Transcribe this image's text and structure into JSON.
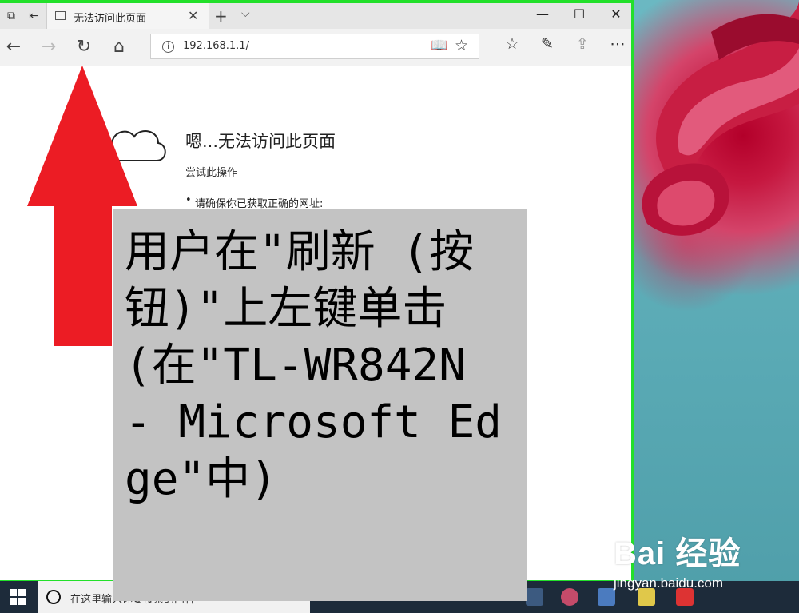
{
  "browser": {
    "tab_title": "无法访问此页面",
    "address": "192.168.1.1/",
    "colors": {
      "window_border": "#22e02a",
      "titlebar": "#e6e6e6"
    }
  },
  "error_page": {
    "title": "嗯...无法访问此页面",
    "subtitle": "尝试此操作",
    "bullet": "请确保你已获取正确的网址:"
  },
  "taskbar": {
    "search_placeholder": "在这里输入你要搜索的内容"
  },
  "annotation": {
    "caption": "用户在\"刷新 (按钮)\"上左键单击(在\"TL-WR842N - Microsoft Edge\"中)",
    "arrow_color": "#ec1c24",
    "caption_bg": "#c3c3c3"
  },
  "watermark": {
    "logo": "Bai 经验",
    "url": "jingyan.baidu.com"
  }
}
